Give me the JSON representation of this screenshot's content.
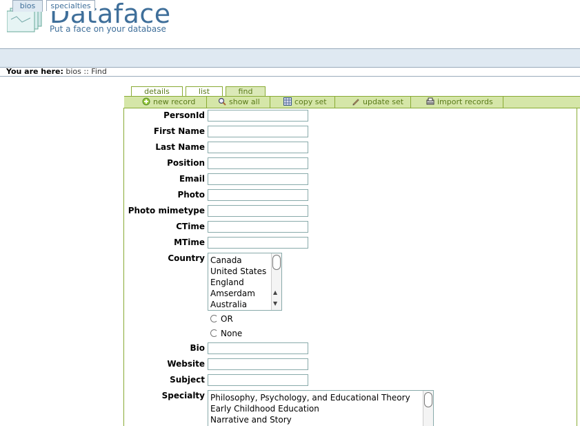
{
  "logo": {
    "title": "Dataface",
    "tagline": "Put a face on your database",
    "icon": "dataface-logo-icon"
  },
  "top_tabs": [
    {
      "label": "bios",
      "active": true
    },
    {
      "label": "specialties",
      "active": false
    }
  ],
  "breadcrumb": {
    "prefix": "You are here:",
    "path": "bios :: Find"
  },
  "sub_tabs": [
    {
      "label": "details"
    },
    {
      "label": "list"
    },
    {
      "label": "find",
      "active": true
    }
  ],
  "actions": [
    {
      "label": "new record",
      "icon": "plus-icon"
    },
    {
      "label": "show all",
      "icon": "magnifier-icon"
    },
    {
      "label": "copy set",
      "icon": "grid-icon"
    },
    {
      "label": "update set",
      "icon": "pencil-icon"
    },
    {
      "label": "import records",
      "icon": "import-icon"
    }
  ],
  "fields": {
    "personid": "PersonId",
    "first_name": "First Name",
    "last_name": "Last Name",
    "position": "Position",
    "email": "Email",
    "photo": "Photo",
    "photo_mimetype": "Photo mimetype",
    "ctime": "CTime",
    "mtime": "MTime",
    "country": "Country",
    "bio": "Bio",
    "website": "Website",
    "subject": "Subject",
    "specialty": "Specialty"
  },
  "country_options": [
    "Canada",
    "United States",
    "England",
    "Amserdam",
    "Australia"
  ],
  "country_radios": {
    "or": "OR",
    "none": "None"
  },
  "specialty_options": [
    "Philosophy, Psychology, and Educational Theory",
    "Early Childhood Education",
    "Narrative and Story"
  ]
}
